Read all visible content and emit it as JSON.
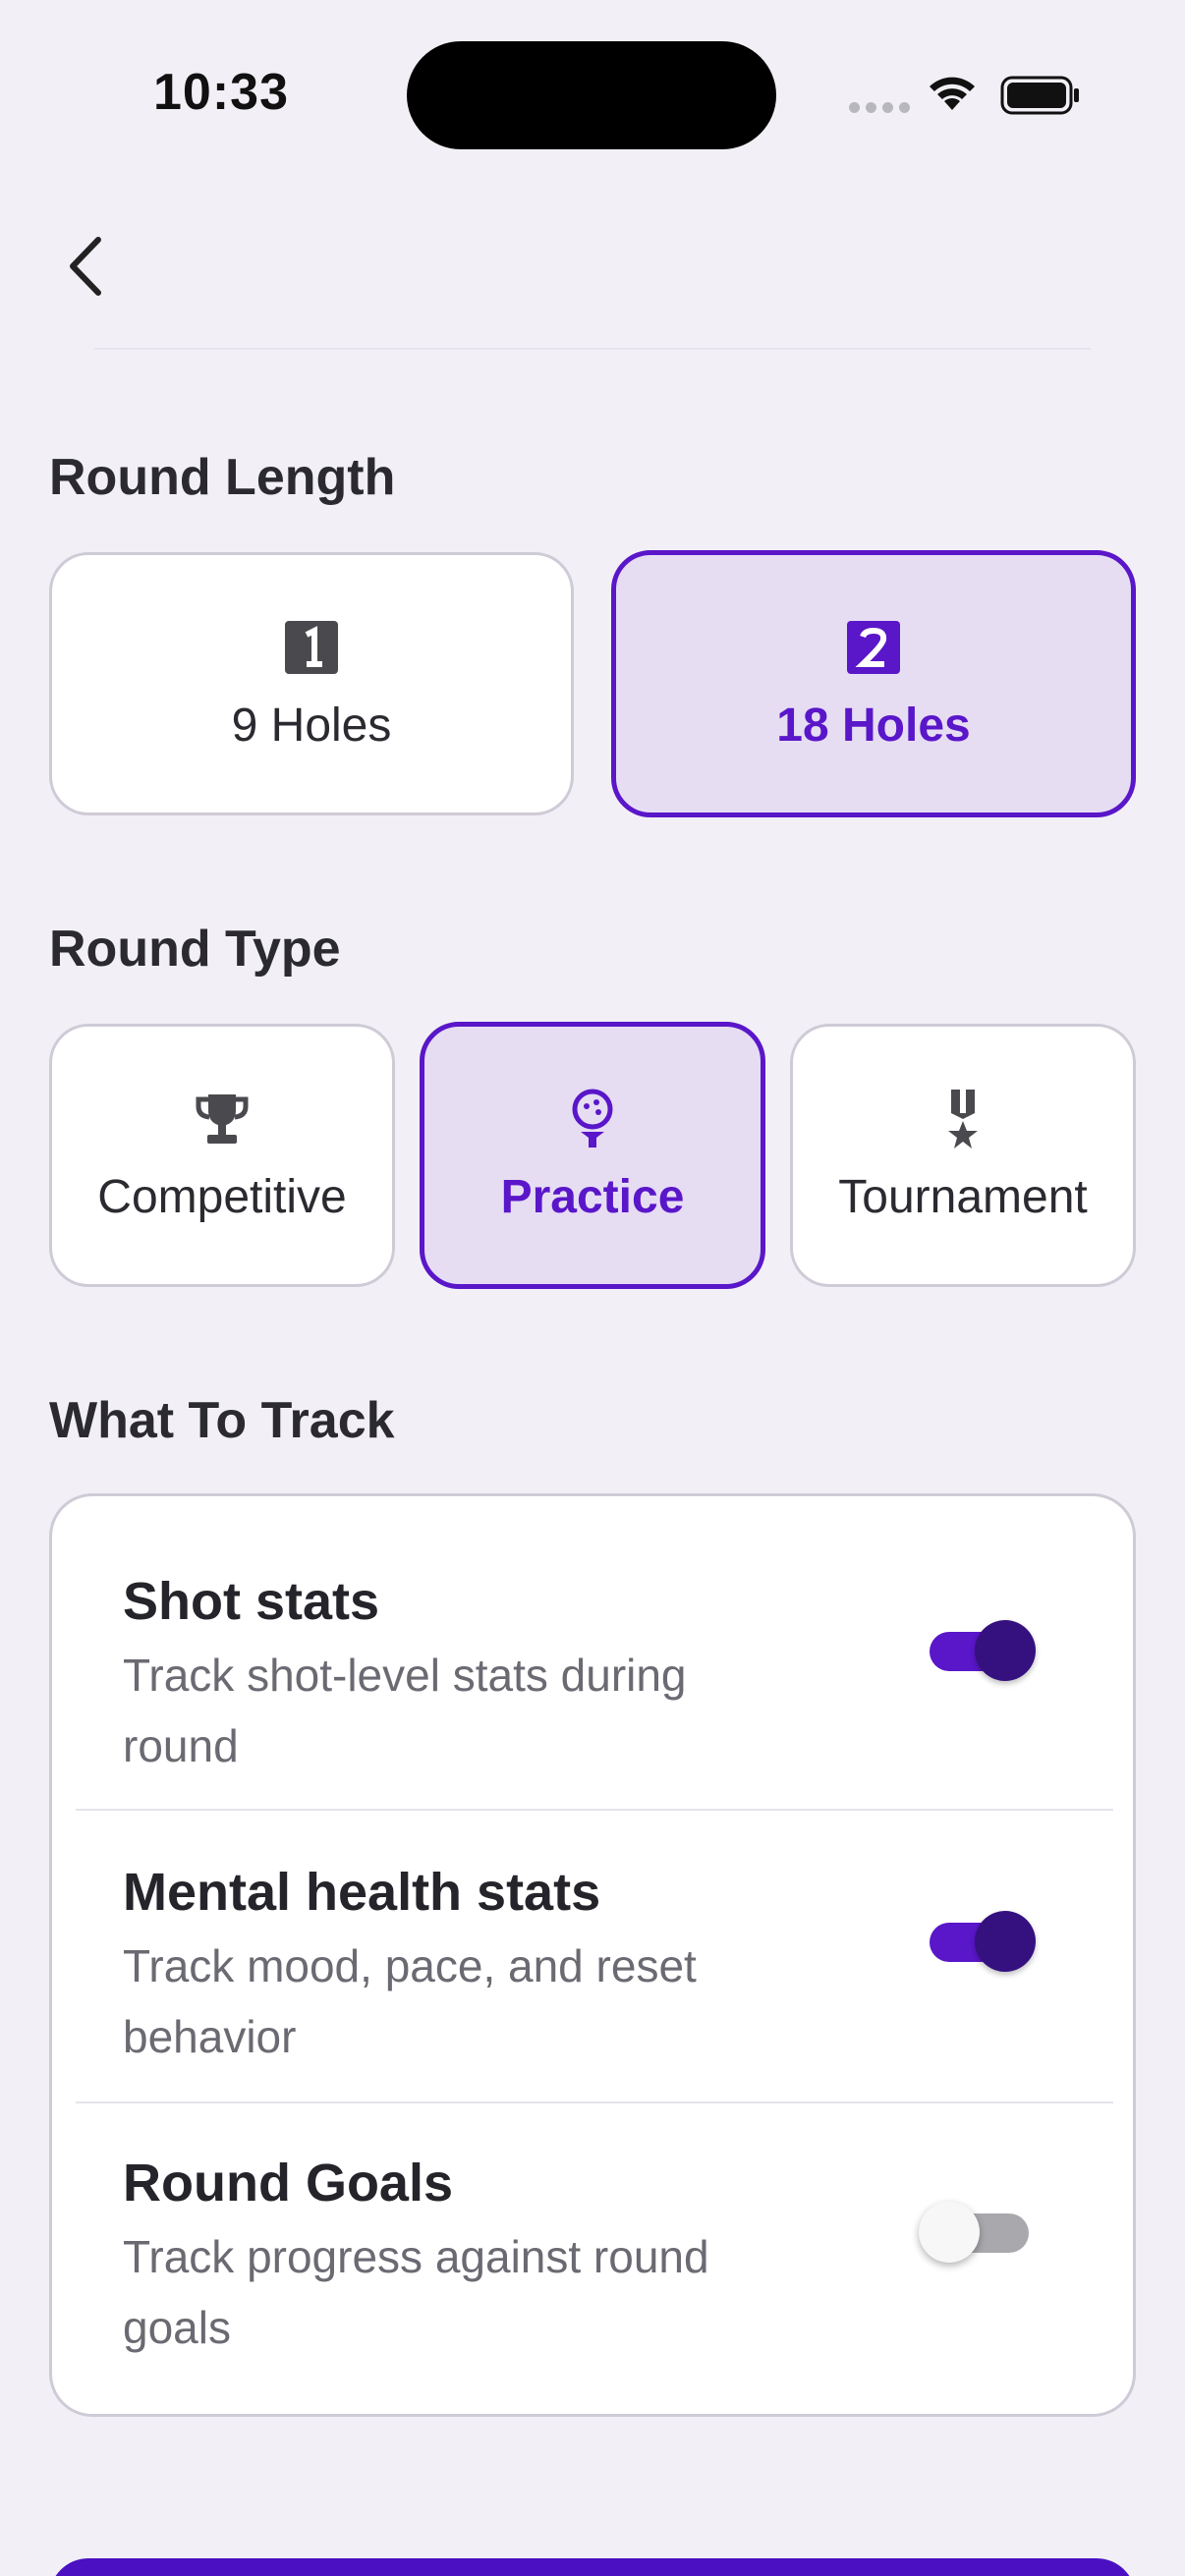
{
  "status_bar": {
    "time": "10:33"
  },
  "round_length": {
    "title": "Round Length",
    "options": [
      {
        "label": "9 Holes",
        "icon": "number-one-icon",
        "selected": false
      },
      {
        "label": "18 Holes",
        "icon": "number-two-icon",
        "selected": true
      }
    ]
  },
  "round_type": {
    "title": "Round Type",
    "options": [
      {
        "label": "Competitive",
        "icon": "trophy-icon",
        "selected": false
      },
      {
        "label": "Practice",
        "icon": "golf-ball-tee-icon",
        "selected": true
      },
      {
        "label": "Tournament",
        "icon": "medal-icon",
        "selected": false
      }
    ]
  },
  "what_to_track": {
    "title": "What To Track",
    "items": [
      {
        "title": "Shot stats",
        "description": "Track shot-level stats during round",
        "enabled": true
      },
      {
        "title": "Mental health stats",
        "description": "Track mood, pace, and reset behavior",
        "enabled": true
      },
      {
        "title": "Round Goals",
        "description": "Track progress against round goals",
        "enabled": false
      }
    ]
  },
  "colors": {
    "accent": "#5a16c9",
    "selected_bg": "#e6ddf3",
    "background": "#f2f0f6"
  }
}
